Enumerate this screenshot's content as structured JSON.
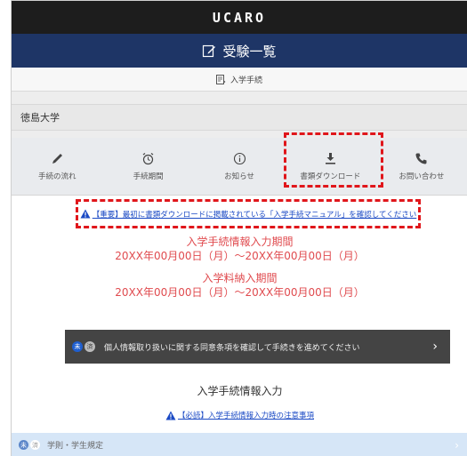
{
  "app": {
    "logo": "UCARO"
  },
  "header": {
    "title": "受験一覧"
  },
  "breadcrumb": {
    "label": "入学手続"
  },
  "university": {
    "name": "徳島大学"
  },
  "menu": [
    {
      "label": "手続の流れ",
      "icon": "pencil-icon"
    },
    {
      "label": "手続期間",
      "icon": "alarm-clock-icon"
    },
    {
      "label": "お知らせ",
      "icon": "info-icon"
    },
    {
      "label": "書類ダウンロード",
      "icon": "download-icon"
    },
    {
      "label": "お問い合わせ",
      "icon": "phone-icon"
    }
  ],
  "notice": {
    "text": "【重要】最初に書類ダウンロードに掲載されている「入学手続マニュアル」を確認してください"
  },
  "periods": [
    {
      "title": "入学手続情報入力期間",
      "range": "20XX年00月00日（月）～20XX年00月00日（月）"
    },
    {
      "title": "入学料納入期間",
      "range": "20XX年00月00日（月）～20XX年00月00日（月）"
    }
  ],
  "consent": {
    "step1": "未",
    "step2": "済",
    "text": "個人情報取り扱いに関する同意条項を確認して手続きを進めてください"
  },
  "section": {
    "title": "入学手続情報入力"
  },
  "required_notice": {
    "text": "【必読】入学手続情報入力時の注意事項"
  },
  "rules": {
    "step1": "未",
    "step2": "済",
    "text": "学則・学生規定"
  },
  "colors": {
    "header_navy": "#1e3566",
    "alert_red": "#e04b4f",
    "link_blue": "#1a49c4",
    "highlight_red": "#e0161b"
  }
}
